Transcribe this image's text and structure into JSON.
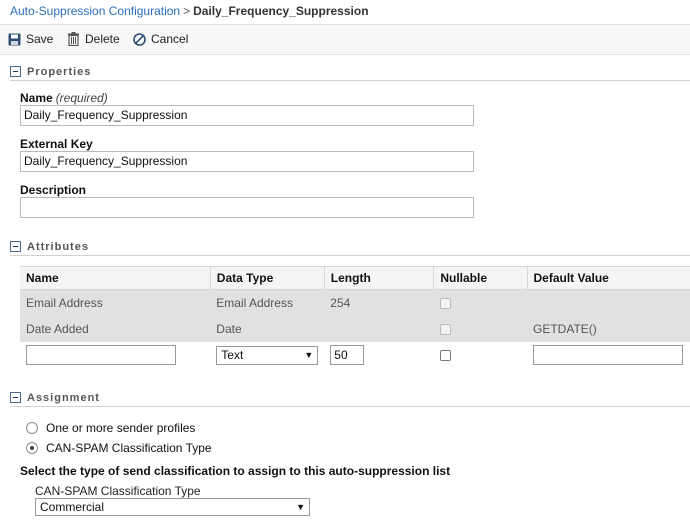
{
  "breadcrumb": {
    "parent": "Auto-Suppression Configuration",
    "separator": ">",
    "current": "Daily_Frequency_Suppression"
  },
  "toolbar": {
    "save_label": "Save",
    "delete_label": "Delete",
    "cancel_label": "Cancel"
  },
  "properties": {
    "section_title": "Properties",
    "name_label": "Name",
    "name_required": "(required)",
    "name_value": "Daily_Frequency_Suppression",
    "external_key_label": "External Key",
    "external_key_value": "Daily_Frequency_Suppression",
    "description_label": "Description",
    "description_value": ""
  },
  "attributes": {
    "section_title": "Attributes",
    "columns": [
      "Name",
      "Data Type",
      "Length",
      "Nullable",
      "Default Value"
    ],
    "rows": [
      {
        "name": "Email Address",
        "data_type": "Email Address",
        "length": "254",
        "nullable": false,
        "default_value": ""
      },
      {
        "name": "Date Added",
        "data_type": "Date",
        "length": "",
        "nullable": false,
        "default_value": "GETDATE()"
      }
    ],
    "new_row": {
      "name": "",
      "data_type": "Text",
      "length": "50",
      "nullable": false,
      "default_value": ""
    }
  },
  "assignment": {
    "section_title": "Assignment",
    "options": [
      {
        "label": "One or more sender profiles",
        "checked": false
      },
      {
        "label": "CAN-SPAM Classification Type",
        "checked": true
      }
    ],
    "instruction": "Select the type of send classification to assign to this auto-suppression list",
    "classification_label": "CAN-SPAM Classification Type",
    "classification_value": "Commercial"
  },
  "icons": {
    "save": "save-icon",
    "delete": "trash-icon",
    "cancel": "cancel-icon",
    "collapse": "collapse-icon"
  },
  "colors": {
    "link": "#2a6ebb",
    "section_title": "#555555",
    "readonly_row": "#e1e1e1"
  }
}
